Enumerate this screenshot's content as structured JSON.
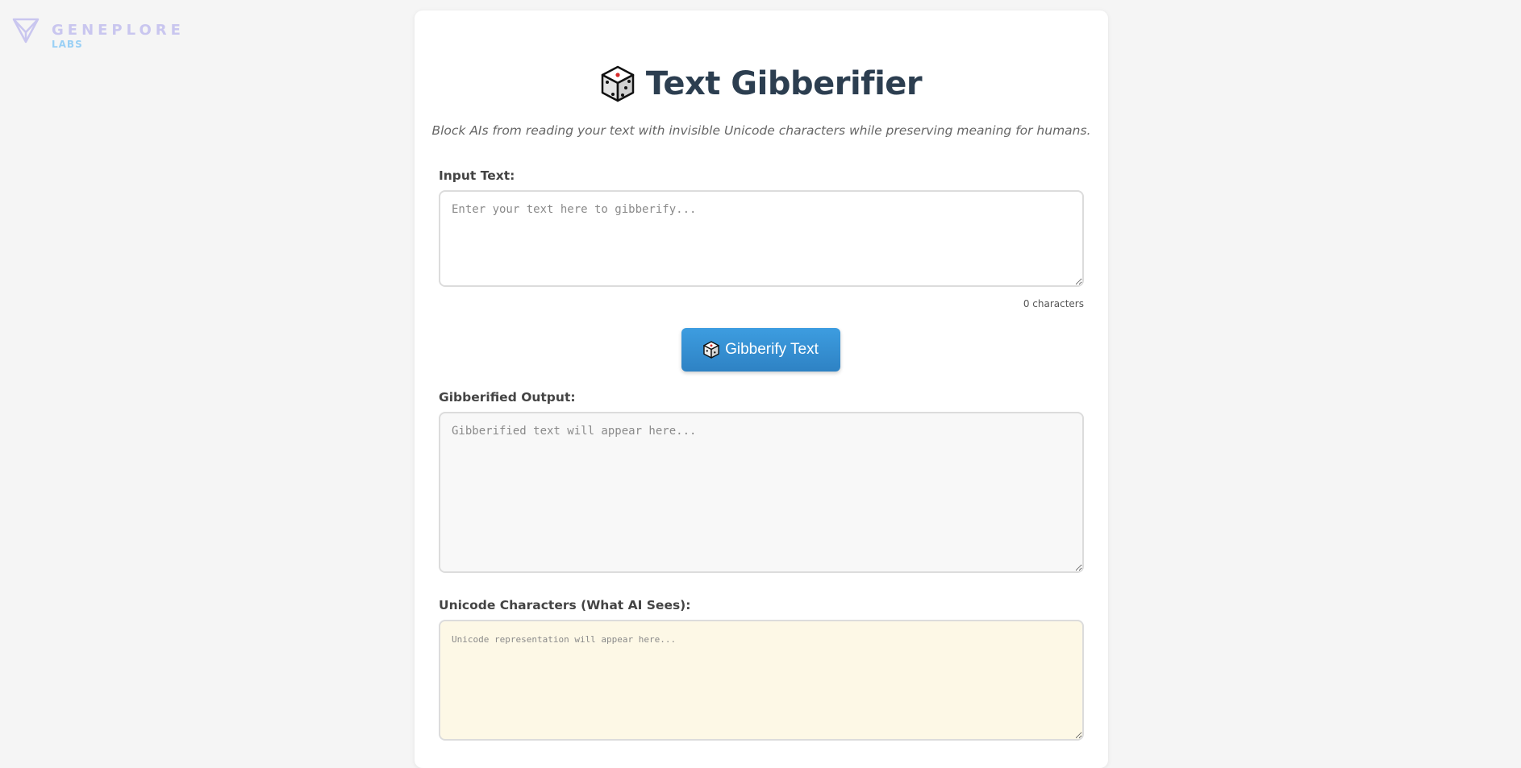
{
  "brand": {
    "name": "GENEPLORE",
    "sub": "LABS",
    "icon": "geneplore-logo-icon"
  },
  "header": {
    "icon": "game-die-icon",
    "title": "Text Gibberifier",
    "subtitle": "Block AIs from reading your text with invisible Unicode characters while preserving meaning for humans."
  },
  "input": {
    "label": "Input Text:",
    "placeholder": "Enter your text here to gibberify...",
    "value": "",
    "char_count": "0 characters"
  },
  "action": {
    "icon": "game-die-icon",
    "label": "Gibberify Text"
  },
  "output": {
    "label": "Gibberified Output:",
    "placeholder": "Gibberified text will appear here..."
  },
  "unicode": {
    "label": "Unicode Characters (What AI Sees):",
    "placeholder": "Unicode representation will appear here..."
  },
  "colors": {
    "accent": "#3498db",
    "title": "#2c3e50",
    "unicode_bg": "#fdf8e6"
  }
}
